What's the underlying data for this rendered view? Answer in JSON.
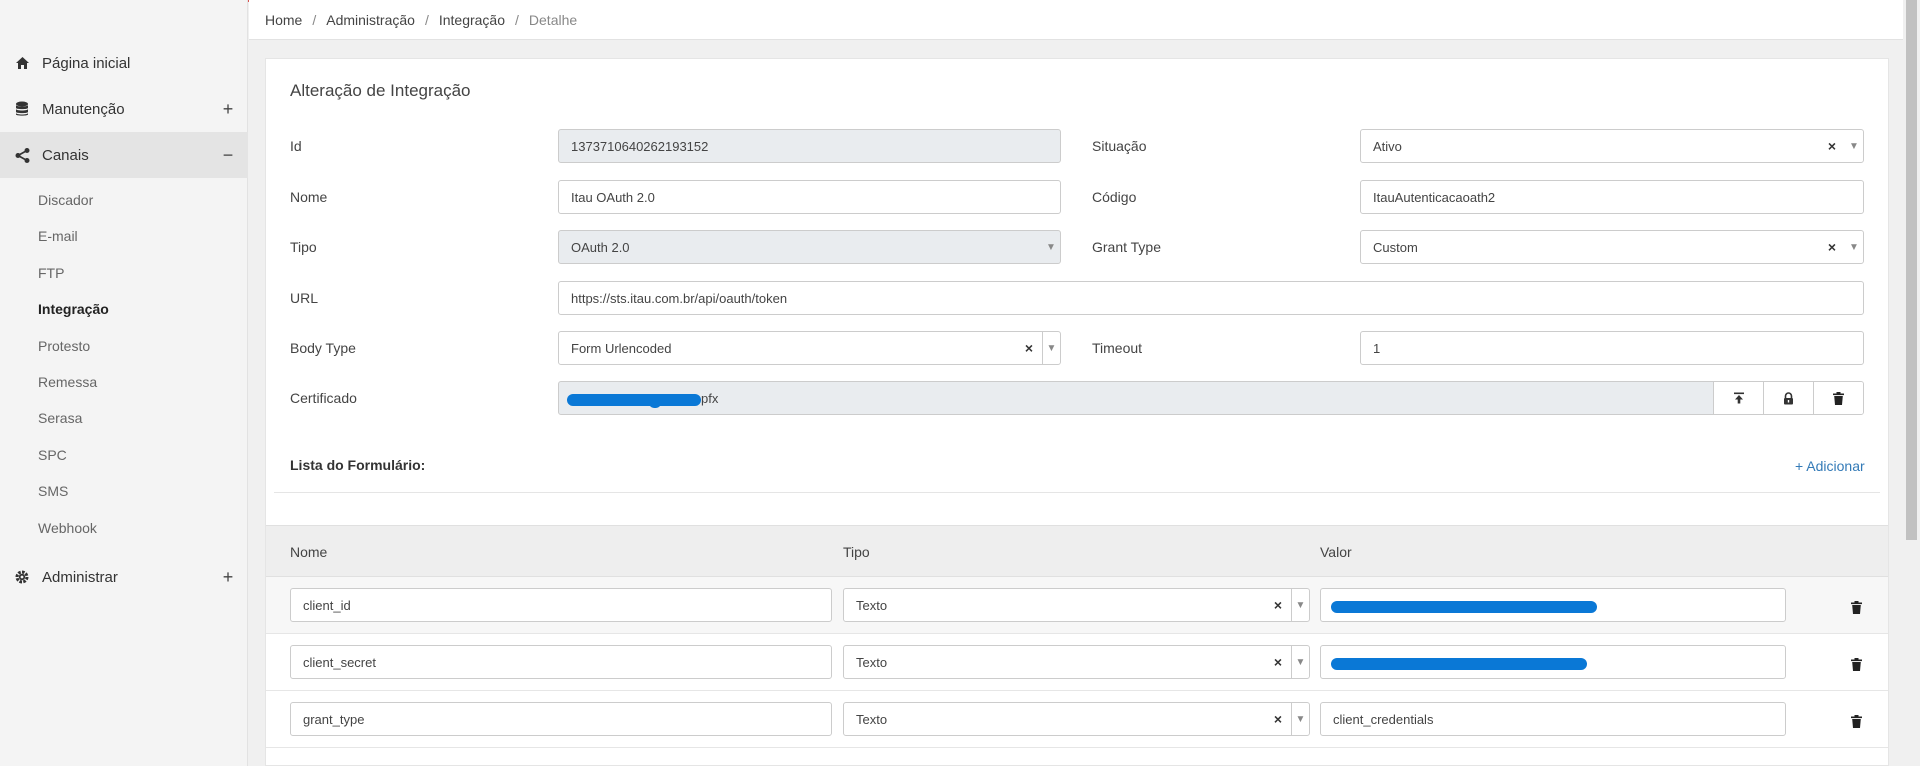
{
  "sidebar": {
    "items": [
      {
        "label": "Página inicial",
        "icon": "home-icon"
      },
      {
        "label": "Manutenção",
        "icon": "database-icon",
        "toggle": "+"
      },
      {
        "label": "Canais",
        "icon": "share-icon",
        "toggle": "−"
      },
      {
        "label": "Administrar",
        "icon": "gear-icon",
        "toggle": "+"
      }
    ],
    "channels": [
      "Discador",
      "E-mail",
      "FTP",
      "Integração",
      "Protesto",
      "Remessa",
      "Serasa",
      "SPC",
      "SMS",
      "Webhook"
    ]
  },
  "breadcrumb": {
    "items": [
      "Home",
      "Administração",
      "Integração",
      "Detalhe"
    ],
    "separator": "/"
  },
  "form": {
    "title": "Alteração de Integração",
    "id": {
      "label": "Id",
      "value": "1373710640262193152"
    },
    "situacao": {
      "label": "Situação",
      "value": "Ativo"
    },
    "nome": {
      "label": "Nome",
      "value": "Itau OAuth 2.0"
    },
    "codigo": {
      "label": "Código",
      "value": "ItauAutenticacaoath2"
    },
    "tipo": {
      "label": "Tipo",
      "value": "OAuth 2.0"
    },
    "grant_type": {
      "label": "Grant Type",
      "value": "Custom"
    },
    "url": {
      "label": "URL",
      "value": "https://sts.itau.com.br/api/oauth/token"
    },
    "body_type": {
      "label": "Body Type",
      "value": "Form Urlencoded"
    },
    "timeout": {
      "label": "Timeout",
      "value": "1"
    },
    "certificado": {
      "label": "Certificado",
      "value_suffix": "pfx"
    }
  },
  "list": {
    "title": "Lista do Formulário:",
    "add_label": "+ Adicionar",
    "columns": [
      "Nome",
      "Tipo",
      "Valor"
    ],
    "rows": [
      {
        "nome": "client_id",
        "tipo": "Texto",
        "valor": "",
        "redacted": true
      },
      {
        "nome": "client_secret",
        "tipo": "Texto",
        "valor": "",
        "redacted": true
      },
      {
        "nome": "grant_type",
        "tipo": "Texto",
        "valor": "client_credentials",
        "redacted": false
      }
    ]
  },
  "colors": {
    "accent_line": "#d9534f",
    "link": "#337ab7",
    "redaction": "#0a78d6"
  }
}
